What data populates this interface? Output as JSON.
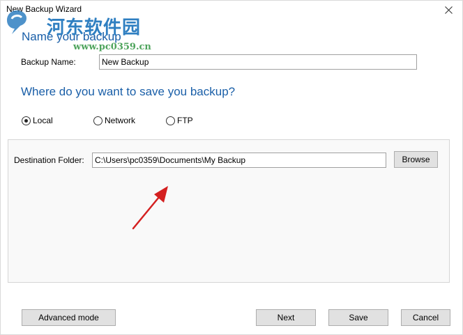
{
  "window": {
    "title": "New Backup Wizard"
  },
  "watermark": {
    "site": "河东软件园",
    "url": "www.pc0359.cn"
  },
  "section1": {
    "heading": "Name your backup",
    "name_label": "Backup Name:",
    "name_value": "New Backup"
  },
  "section2": {
    "heading": "Where do you want to save you backup?",
    "options": [
      {
        "label": "Local",
        "selected": true
      },
      {
        "label": "Network",
        "selected": false
      },
      {
        "label": "FTP",
        "selected": false
      }
    ]
  },
  "destination": {
    "label": "Destination Folder:",
    "value": "C:\\Users\\pc0359\\Documents\\My Backup",
    "browse_label": "Browse"
  },
  "footer": {
    "advanced_label": "Advanced mode",
    "next_label": "Next",
    "save_label": "Save",
    "cancel_label": "Cancel"
  },
  "colors": {
    "heading": "#1a5fa8",
    "watermark_text": "#2f7fc1",
    "watermark_url": "#4ea45c",
    "annotation_arrow": "#d42020"
  }
}
